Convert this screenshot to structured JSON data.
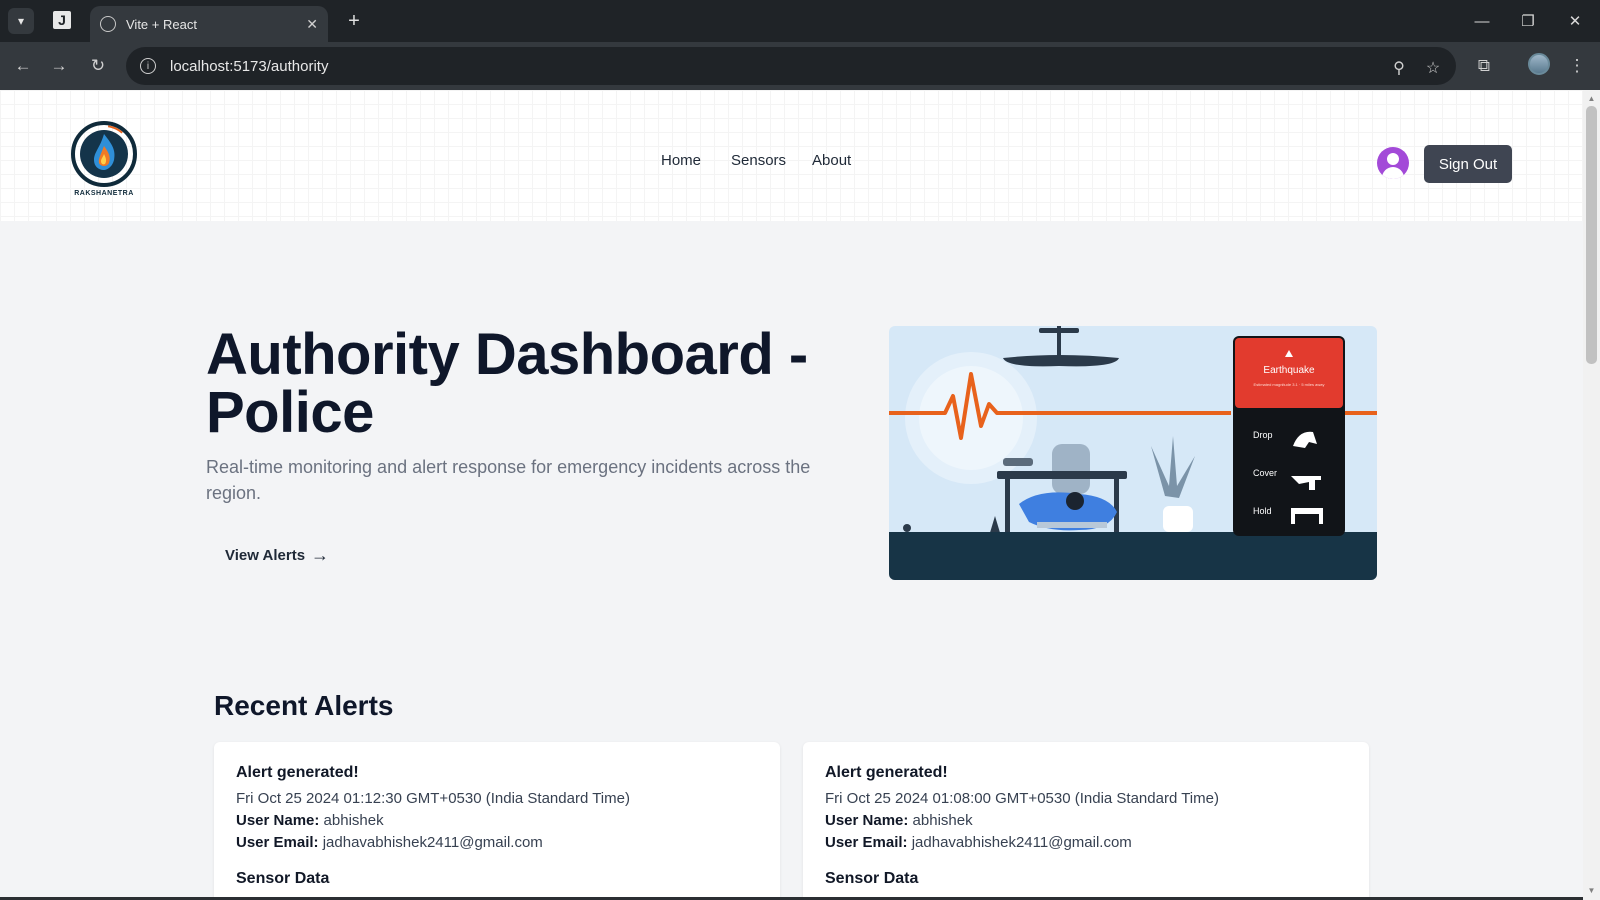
{
  "browser": {
    "tab_title": "Vite + React",
    "tab_close": "✕",
    "new_tab": "+",
    "url": "localhost:5173/authority"
  },
  "site": {
    "brand": "RAKSHANETRA",
    "nav": [
      "Home",
      "Sensors",
      "About"
    ],
    "sign_out": "Sign Out"
  },
  "hero": {
    "title": "Authority Dashboard - Police",
    "subtitle": "Real-time monitoring and alert response for emergency incidents across the region.",
    "cta": "View Alerts"
  },
  "illustration": {
    "phone_heading": "Earthquake",
    "phone_caption": "Estimated magnitude 3.1 · 5 miles away",
    "steps": [
      "Drop",
      "Cover",
      "Hold"
    ]
  },
  "alerts": {
    "heading": "Recent Alerts",
    "items": [
      {
        "title": "Alert generated!",
        "timestamp": "Fri Oct 25 2024 01:12:30 GMT+0530 (India Standard Time)",
        "user_name_label": "User Name:",
        "user_name": "abhishek",
        "user_email_label": "User Email:",
        "user_email": "jadhavabhishek2411@gmail.com",
        "sensor_heading": "Sensor Data"
      },
      {
        "title": "Alert generated!",
        "timestamp": "Fri Oct 25 2024 01:08:00 GMT+0530 (India Standard Time)",
        "user_name_label": "User Name:",
        "user_name": "abhishek",
        "user_email_label": "User Email:",
        "user_email": "jadhavabhishek2411@gmail.com",
        "sensor_heading": "Sensor Data"
      }
    ]
  },
  "colors": {
    "accent_orange": "#e8621c",
    "phone_red": "#e23b2e",
    "sign_out_bg": "#3f4552",
    "avatar": "#a34ad8"
  }
}
